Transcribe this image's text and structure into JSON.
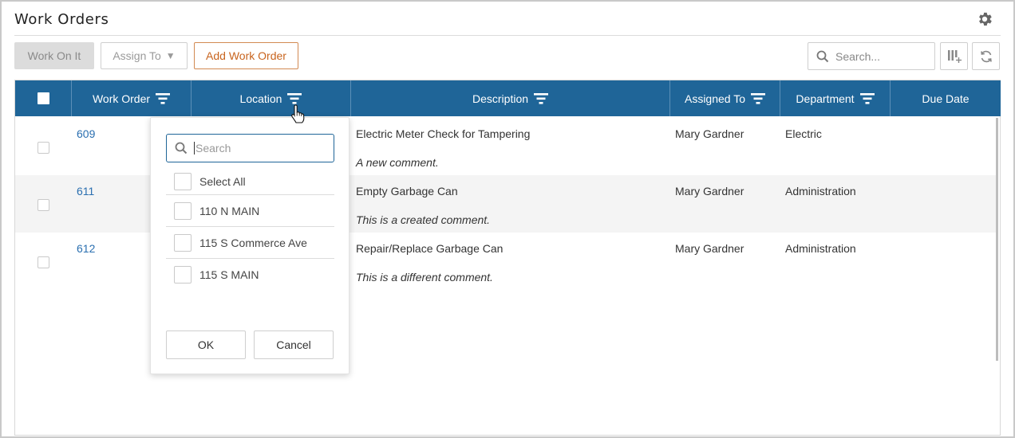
{
  "page": {
    "title": "Work Orders"
  },
  "toolbar": {
    "work_on_it": "Work On It",
    "assign_to": "Assign To",
    "assign_caret": "▼",
    "add_work_order": "Add Work Order",
    "search_placeholder": "Search..."
  },
  "icons": {
    "settings": "gear-icon",
    "search": "search-icon",
    "columns": "column-chooser-icon",
    "refresh": "refresh-icon",
    "filter": "filter-icon"
  },
  "colors": {
    "header": "#1f6598",
    "link": "#2a6fb0",
    "add_button": "#c8641e"
  },
  "grid": {
    "columns": [
      "Work Order",
      "Location",
      "Description",
      "Assigned To",
      "Department",
      "Due Date"
    ],
    "rows": [
      {
        "work_order": "609",
        "description": "Electric Meter Check for Tampering",
        "comment": "A new comment.",
        "assigned_to": "Mary Gardner",
        "department": "Electric",
        "due_date": ""
      },
      {
        "work_order": "611",
        "description": "Empty Garbage Can",
        "comment": "This is a created comment.",
        "assigned_to": "Mary Gardner",
        "department": "Administration",
        "due_date": ""
      },
      {
        "work_order": "612",
        "description": "Repair/Replace Garbage Can",
        "comment": "This is a different comment.",
        "assigned_to": "Mary Gardner",
        "department": "Administration",
        "due_date": ""
      }
    ]
  },
  "location_filter": {
    "search_placeholder": "Search",
    "select_all": "Select All",
    "options": [
      "110 N MAIN",
      "115 S Commerce Ave",
      "115 S MAIN"
    ],
    "ok": "OK",
    "cancel": "Cancel"
  }
}
